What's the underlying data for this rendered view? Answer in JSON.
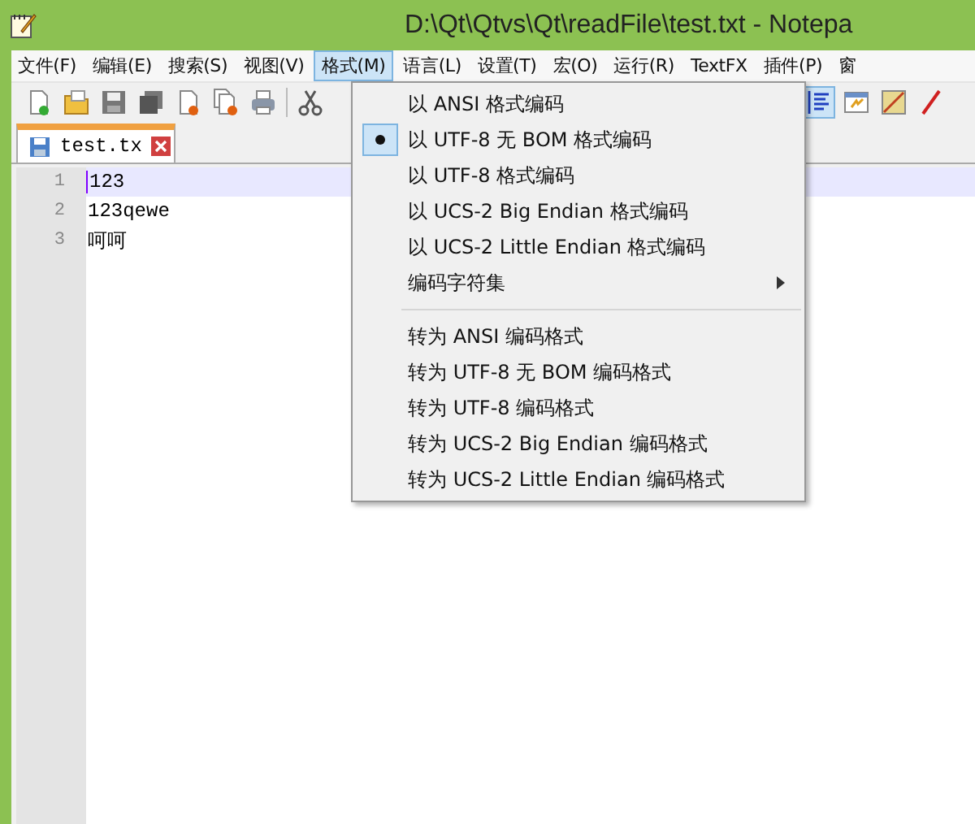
{
  "window": {
    "title": "D:\\Qt\\Qtvs\\Qt\\readFile\\test.txt - Notepa"
  },
  "menu_bar": [
    {
      "label": "文件(F)",
      "selected": false
    },
    {
      "label": "编辑(E)",
      "selected": false
    },
    {
      "label": "搜索(S)",
      "selected": false
    },
    {
      "label": "视图(V)",
      "selected": false
    },
    {
      "label": "格式(M)",
      "selected": true
    },
    {
      "label": "语言(L)",
      "selected": false
    },
    {
      "label": "设置(T)",
      "selected": false
    },
    {
      "label": "宏(O)",
      "selected": false
    },
    {
      "label": "运行(R)",
      "selected": false
    },
    {
      "label": "TextFX",
      "selected": false
    },
    {
      "label": "插件(P)",
      "selected": false
    },
    {
      "label": "窗",
      "selected": false
    }
  ],
  "tabs": [
    {
      "label": "test.tx",
      "selected": true
    }
  ],
  "editor": {
    "lines": [
      {
        "number": "1",
        "text": "123",
        "current": true
      },
      {
        "number": "2",
        "text": "123qewe",
        "current": false
      },
      {
        "number": "3",
        "text": "呵呵",
        "current": false
      }
    ]
  },
  "format_menu": {
    "items": [
      {
        "kind": "item",
        "label": "以 ANSI 格式编码",
        "selected": false
      },
      {
        "kind": "item",
        "label": "以 UTF-8 无 BOM 格式编码",
        "selected": true
      },
      {
        "kind": "item",
        "label": "以 UTF-8 格式编码",
        "selected": false
      },
      {
        "kind": "item",
        "label": "以 UCS-2 Big Endian 格式编码",
        "selected": false
      },
      {
        "kind": "item",
        "label": "以 UCS-2 Little Endian 格式编码",
        "selected": false
      },
      {
        "kind": "submenu",
        "label": "编码字符集"
      },
      {
        "kind": "separator"
      },
      {
        "kind": "item",
        "label": "转为 ANSI 编码格式",
        "selected": false
      },
      {
        "kind": "item",
        "label": "转为 UTF-8 无 BOM 编码格式",
        "selected": false
      },
      {
        "kind": "item",
        "label": "转为 UTF-8 编码格式",
        "selected": false
      },
      {
        "kind": "item",
        "label": "转为 UCS-2 Big Endian 编码格式",
        "selected": false
      },
      {
        "kind": "item",
        "label": "转为 UCS-2 Little Endian 编码格式",
        "selected": false
      }
    ]
  }
}
